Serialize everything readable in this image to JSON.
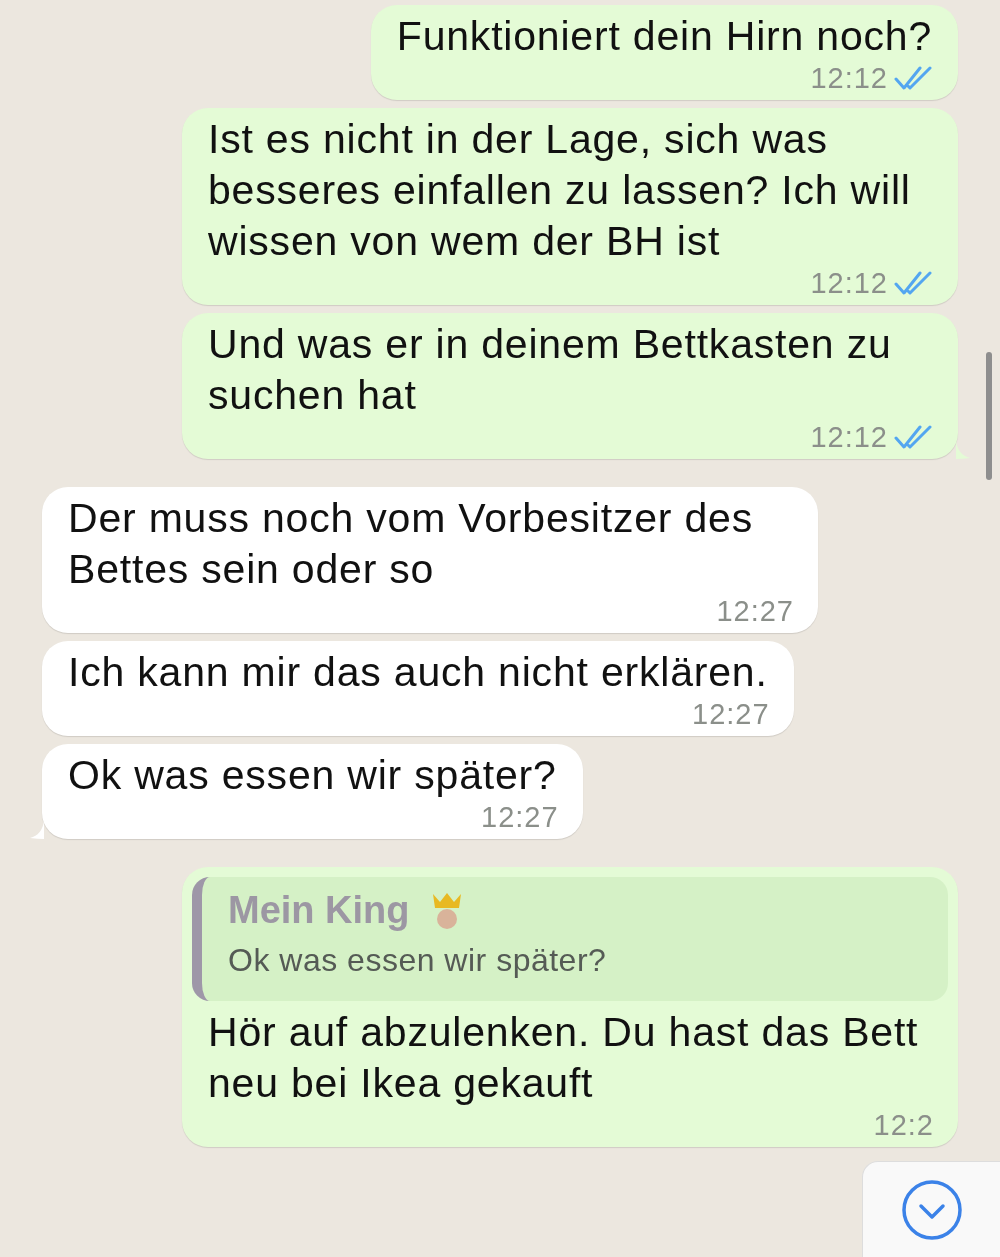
{
  "messages": [
    {
      "kind": "outgoing",
      "text": "Funktioniert dein Hirn noch?",
      "time": "12:12",
      "read": true,
      "tail": false
    },
    {
      "kind": "outgoing",
      "text": "Ist es nicht in der Lage, sich was besseres einfallen zu lassen? Ich will wissen von wem der BH ist",
      "time": "12:12",
      "read": true,
      "tail": false
    },
    {
      "kind": "outgoing",
      "text": "Und was er in deinem Bettkasten zu suchen hat",
      "time": "12:12",
      "read": true,
      "tail": true
    },
    {
      "kind": "incoming",
      "text": "Der muss noch vom Vorbesitzer des Bettes sein oder so",
      "time": "12:27",
      "tail": false
    },
    {
      "kind": "incoming",
      "text": "Ich kann mir das auch nicht erklären.",
      "time": "12:27",
      "tail": false
    },
    {
      "kind": "incoming",
      "text": "Ok was essen wir später?",
      "time": "12:27",
      "tail": true
    },
    {
      "kind": "outgoing",
      "quote": {
        "author": "Mein King",
        "text": "Ok was essen wir später?"
      },
      "text": "Hör auf abzulenken. Du hast das Bett neu bei Ikea gekauft",
      "time": "12:2",
      "tail": false
    }
  ]
}
